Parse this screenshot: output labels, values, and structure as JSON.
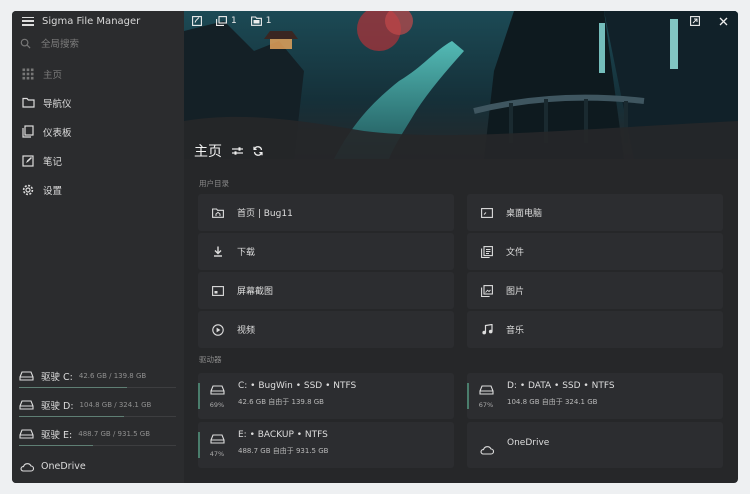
{
  "app": {
    "title": "Sigma File Manager"
  },
  "search": {
    "placeholder": "全局搜索"
  },
  "nav": [
    {
      "label": "主页",
      "icon": "grid-icon"
    },
    {
      "label": "导航仪",
      "icon": "folder-icon"
    },
    {
      "label": "仪表板",
      "icon": "dashboard-icon"
    },
    {
      "label": "笔记",
      "icon": "note-icon"
    },
    {
      "label": "设置",
      "icon": "gear-icon"
    }
  ],
  "sidebar_drives": [
    {
      "letter": "驱驶 C:",
      "size": "42.6 GB / 139.8 GB",
      "fill": 0.69
    },
    {
      "letter": "驱驶 D:",
      "size": "104.8 GB / 324.1 GB",
      "fill": 0.67
    },
    {
      "letter": "驱驶 E:",
      "size": "488.7 GB / 931.5 GB",
      "fill": 0.47
    }
  ],
  "sidebar_onedrive": "OneDrive",
  "topbar": {
    "tabs_count": "1",
    "workspaces_count": "1"
  },
  "page": {
    "title": "主页"
  },
  "user_dirs": {
    "title": "用户目录",
    "items": [
      {
        "label": "首页 | Bug11",
        "icon": "home-folder-icon"
      },
      {
        "label": "桌面电脑",
        "icon": "desktop-icon"
      },
      {
        "label": "下载",
        "icon": "download-icon"
      },
      {
        "label": "文件",
        "icon": "documents-icon"
      },
      {
        "label": "屏幕截图",
        "icon": "screenshot-icon"
      },
      {
        "label": "图片",
        "icon": "pictures-icon"
      },
      {
        "label": "视频",
        "icon": "video-icon"
      },
      {
        "label": "音乐",
        "icon": "music-icon"
      }
    ]
  },
  "drives": {
    "title": "驱动器",
    "items": [
      {
        "name": "C: • BugWin • SSD • NTFS",
        "free": "42.6 GB 自由于 139.8 GB",
        "percent": "69%"
      },
      {
        "name": "D: • DATA • SSD • NTFS",
        "free": "104.8 GB 自由于 324.1 GB",
        "percent": "67%"
      },
      {
        "name": "E: • BACKUP • NTFS",
        "free": "488.7 GB 自由于 931.5 GB",
        "percent": "47%"
      }
    ],
    "onedrive": "OneDrive"
  },
  "colors": {
    "accent": "#4a7d6c",
    "background": "#262729",
    "sidebar": "#2b2c2e",
    "card": "#2c2d30"
  }
}
